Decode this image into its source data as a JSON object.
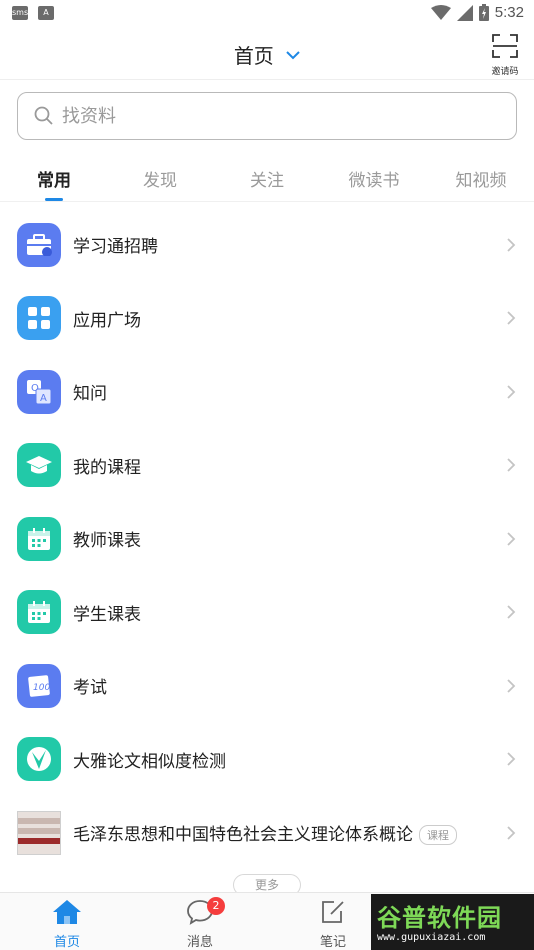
{
  "status_bar": {
    "time": "5:32",
    "left_icons": [
      "sms-notification-icon",
      "a-notification-icon"
    ]
  },
  "header": {
    "title": "首页",
    "scan_label": "邀请码"
  },
  "search": {
    "placeholder": "找资料"
  },
  "tabs": [
    {
      "label": "常用",
      "active": true
    },
    {
      "label": "发现",
      "active": false
    },
    {
      "label": "关注",
      "active": false
    },
    {
      "label": "微读书",
      "active": false
    },
    {
      "label": "知视频",
      "active": false
    }
  ],
  "list": [
    {
      "label": "学习通招聘",
      "icon": "briefcase-icon",
      "color": "#5b7cf0"
    },
    {
      "label": "应用广场",
      "icon": "apps-grid-icon",
      "color": "#3aa0f0"
    },
    {
      "label": "知问",
      "icon": "qa-icon",
      "color": "#5b7cf0"
    },
    {
      "label": "我的课程",
      "icon": "graduation-cap-icon",
      "color": "#22c9a8"
    },
    {
      "label": "教师课表",
      "icon": "calendar-icon",
      "color": "#22c9a8"
    },
    {
      "label": "学生课表",
      "icon": "calendar-icon",
      "color": "#22c9a8"
    },
    {
      "label": "考试",
      "icon": "exam-icon",
      "color": "#5b7cf0"
    },
    {
      "label": "大雅论文相似度检测",
      "icon": "check-icon",
      "color": "#22c9a8"
    },
    {
      "label": "毛泽东思想和中国特色社会主义理论体系概论",
      "icon": "book-thumbnail",
      "badge": "课程"
    }
  ],
  "more_label": "更多",
  "bottom_nav": [
    {
      "label": "首页",
      "icon": "home-icon",
      "active": true
    },
    {
      "label": "消息",
      "icon": "message-icon",
      "badge": "2"
    },
    {
      "label": "笔记",
      "icon": "note-icon"
    }
  ],
  "watermark": {
    "title": "谷普软件园",
    "url": "www.gupuxiazai.com"
  }
}
